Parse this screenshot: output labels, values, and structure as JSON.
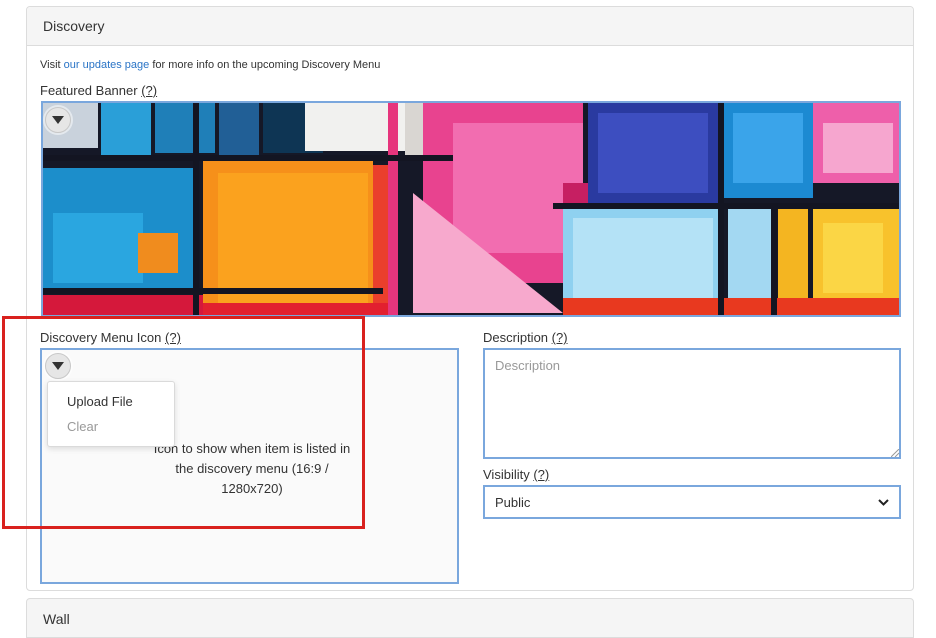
{
  "section": {
    "title": "Discovery",
    "info": {
      "prefix": "Visit ",
      "link_text": "our updates page",
      "suffix": " for more info on the upcoming Discovery Menu"
    }
  },
  "featured_banner": {
    "label": "Featured Banner",
    "help": "(?)",
    "toggle_icon": "caret-down-icon"
  },
  "discovery_menu_icon": {
    "label": "Discovery Menu Icon",
    "help": "(?)",
    "hint": "Icon to show when item is listed in the discovery menu (16:9 / 1280x720)",
    "toggle_icon": "caret-down-icon",
    "menu": {
      "upload": "Upload File",
      "clear": "Clear"
    }
  },
  "description": {
    "label": "Description",
    "help": "(?)",
    "placeholder": "Description",
    "value": ""
  },
  "visibility": {
    "label": "Visibility",
    "help": "(?)",
    "selected": "Public"
  },
  "next_section": {
    "title": "Wall"
  },
  "colors": {
    "link": "#2a74c6",
    "focus_border": "#7aa7dd",
    "highlight": "#d9211e",
    "header_bg": "#f5f5f5"
  }
}
